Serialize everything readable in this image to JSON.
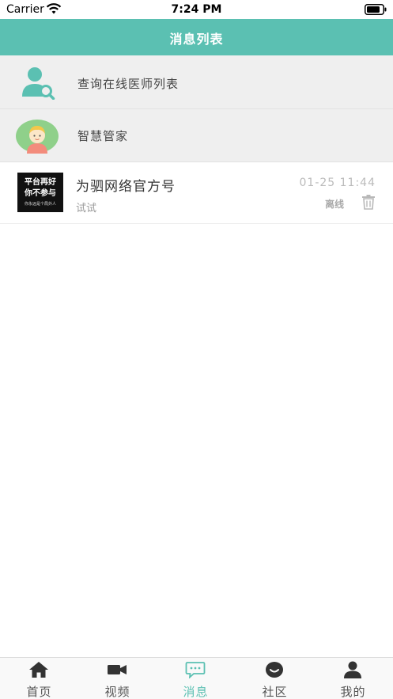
{
  "status_bar": {
    "carrier": "Carrier",
    "time": "7:24 PM"
  },
  "nav": {
    "title": "消息列表"
  },
  "rows": {
    "doctor_search": {
      "label": "查询在线医师列表",
      "icon": "doctor-search-icon"
    },
    "assistant": {
      "label": "智慧管家",
      "icon": "assistant-avatar-icon"
    }
  },
  "messages": [
    {
      "name": "为驷网络官方号",
      "preview": "试试",
      "time": "01-25 11:44",
      "status": "离线",
      "avatar_lines": [
        "平台再好",
        "你不参与",
        "你永远是个局外人"
      ]
    }
  ],
  "tabs": [
    {
      "label": "首页",
      "icon": "home-icon",
      "active": false
    },
    {
      "label": "视频",
      "icon": "video-camera-icon",
      "active": false
    },
    {
      "label": "消息",
      "icon": "message-icon",
      "active": true
    },
    {
      "label": "社区",
      "icon": "community-icon",
      "active": false
    },
    {
      "label": "我的",
      "icon": "profile-icon",
      "active": false
    }
  ],
  "colors": {
    "accent": "#5bc0b2",
    "nav_background": "#5bc0b2",
    "row_background": "#efefef",
    "inactive_tab": "#555555"
  }
}
